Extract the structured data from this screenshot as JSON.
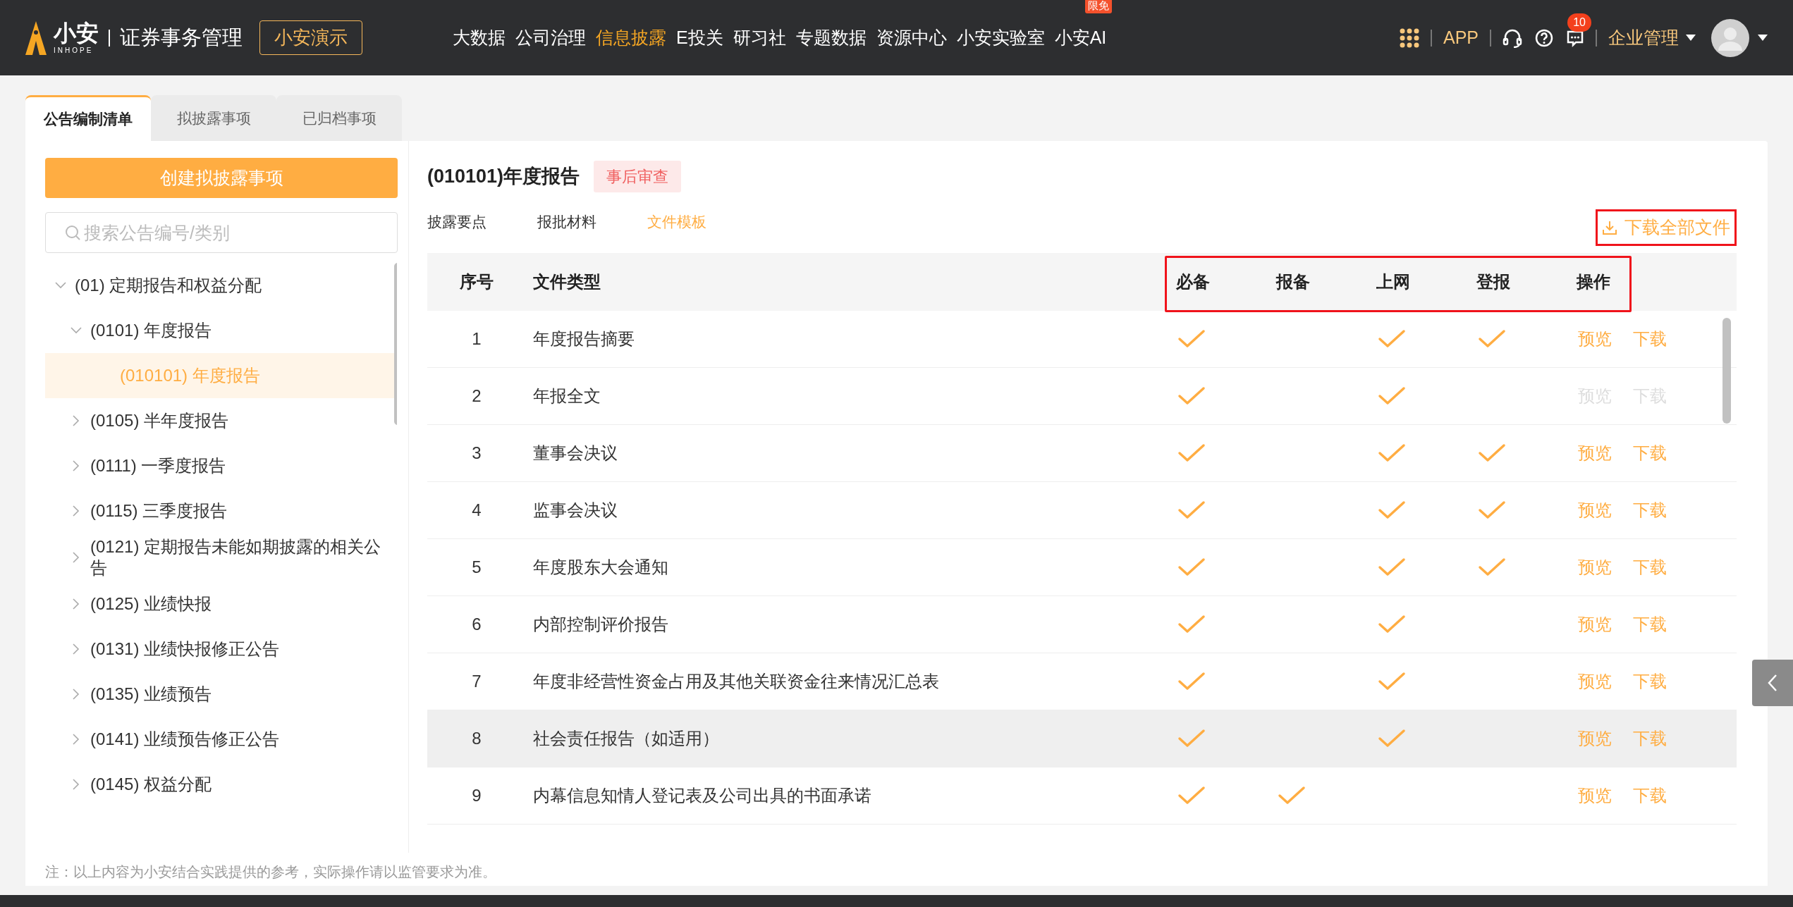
{
  "header": {
    "logo": {
      "name": "小安",
      "sub": "INHOPE"
    },
    "product": "证券事务管理",
    "demo_button": "小安演示",
    "nav": [
      {
        "label": "大数据",
        "selected": false
      },
      {
        "label": "公司治理",
        "selected": false
      },
      {
        "label": "信息披露",
        "selected": true
      },
      {
        "label": "E投关",
        "selected": false
      },
      {
        "label": "研习社",
        "selected": false
      },
      {
        "label": "专题数据",
        "selected": false
      },
      {
        "label": "资源中心",
        "selected": false
      },
      {
        "label": "小安实验室",
        "selected": false
      },
      {
        "label": "小安AI",
        "selected": false,
        "badge": "限免"
      }
    ],
    "app_link": "APP",
    "message_count": "10",
    "org_menu": "企业管理"
  },
  "left_tabs": [
    {
      "label": "公告编制清单",
      "selected": true
    },
    {
      "label": "拟披露事项",
      "selected": false
    },
    {
      "label": "已归档事项",
      "selected": false
    }
  ],
  "create_button": "创建拟披露事项",
  "search": {
    "placeholder": "搜索公告编号/类别"
  },
  "tree": [
    {
      "label": "(01) 定期报告和权益分配",
      "expanded": true,
      "selected": false,
      "children": [
        {
          "label": "(0101) 年度报告",
          "expanded": true,
          "selected": false,
          "children": [
            {
              "label": "(010101) 年度报告",
              "selected": true
            }
          ]
        },
        {
          "label": "(0105) 半年度报告",
          "expanded": false,
          "selected": false
        },
        {
          "label": "(0111) 一季度报告",
          "expanded": false,
          "selected": false
        },
        {
          "label": "(0115) 三季度报告",
          "expanded": false,
          "selected": false
        },
        {
          "label": "(0121) 定期报告未能如期披露的相关公告",
          "expanded": false,
          "selected": false
        },
        {
          "label": "(0125) 业绩快报",
          "expanded": false,
          "selected": false
        },
        {
          "label": "(0131) 业绩快报修正公告",
          "expanded": false,
          "selected": false
        },
        {
          "label": "(0135) 业绩预告",
          "expanded": false,
          "selected": false
        },
        {
          "label": "(0141) 业绩预告修正公告",
          "expanded": false,
          "selected": false
        },
        {
          "label": "(0145) 权益分配",
          "expanded": false,
          "selected": false
        }
      ]
    }
  ],
  "detail": {
    "title": "(010101)年度报告",
    "tag": "事后审查",
    "tabs": [
      {
        "label": "披露要点",
        "selected": false
      },
      {
        "label": "报批材料",
        "selected": false
      },
      {
        "label": "文件模板",
        "selected": true
      }
    ],
    "download_all": "下载全部文件",
    "table": {
      "columns": [
        "序号",
        "文件类型",
        "必备",
        "报备",
        "上网",
        "登报",
        "操作"
      ],
      "rows": [
        {
          "index": "1",
          "type": "年度报告摘要",
          "required": true,
          "filing": false,
          "online": true,
          "newspaper": true,
          "disabled": false,
          "highlighted": false,
          "actions": [
            "预览",
            "下载"
          ]
        },
        {
          "index": "2",
          "type": "年报全文",
          "required": true,
          "filing": false,
          "online": true,
          "newspaper": false,
          "disabled": true,
          "highlighted": false,
          "actions": [
            "预览",
            "下载"
          ]
        },
        {
          "index": "3",
          "type": "董事会决议",
          "required": true,
          "filing": false,
          "online": true,
          "newspaper": true,
          "disabled": false,
          "highlighted": false,
          "actions": [
            "预览",
            "下载"
          ]
        },
        {
          "index": "4",
          "type": "监事会决议",
          "required": true,
          "filing": false,
          "online": true,
          "newspaper": true,
          "disabled": false,
          "highlighted": false,
          "actions": [
            "预览",
            "下载"
          ]
        },
        {
          "index": "5",
          "type": "年度股东大会通知",
          "required": true,
          "filing": false,
          "online": true,
          "newspaper": true,
          "disabled": false,
          "highlighted": false,
          "actions": [
            "预览",
            "下载"
          ]
        },
        {
          "index": "6",
          "type": "内部控制评价报告",
          "required": true,
          "filing": false,
          "online": true,
          "newspaper": false,
          "disabled": false,
          "highlighted": false,
          "actions": [
            "预览",
            "下载"
          ]
        },
        {
          "index": "7",
          "type": "年度非经营性资金占用及其他关联资金往来情况汇总表",
          "required": true,
          "filing": false,
          "online": true,
          "newspaper": false,
          "disabled": false,
          "highlighted": false,
          "actions": [
            "预览",
            "下载"
          ]
        },
        {
          "index": "8",
          "type": "社会责任报告（如适用）",
          "required": true,
          "filing": false,
          "online": true,
          "newspaper": false,
          "disabled": false,
          "highlighted": true,
          "actions": [
            "预览",
            "下载"
          ]
        },
        {
          "index": "9",
          "type": "内幕信息知情人登记表及公司出具的书面承诺",
          "required": true,
          "filing": true,
          "online": false,
          "newspaper": false,
          "disabled": false,
          "highlighted": false,
          "actions": [
            "预览",
            "下载"
          ]
        }
      ]
    }
  },
  "footnote": "注：以上内容为小安结合实践提供的参考，实际操作请以监管要求为准。"
}
